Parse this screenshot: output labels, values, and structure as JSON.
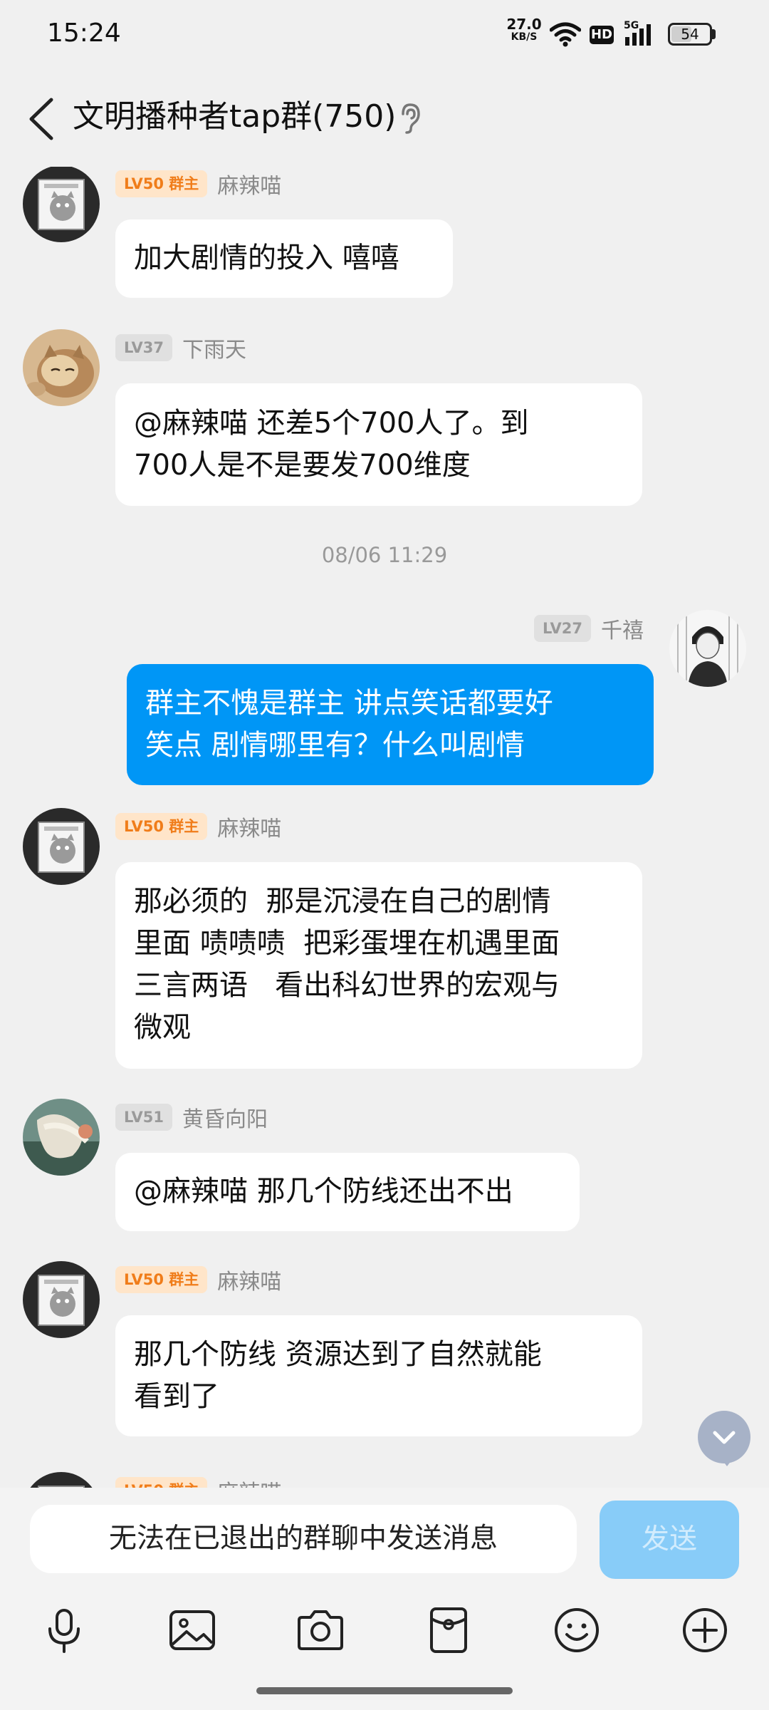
{
  "status_bar": {
    "time": "15:24",
    "net_speed_value": "27.0",
    "net_speed_unit": "KB/S",
    "hd_label": "HD",
    "signal_label": "5G",
    "battery_level": "54",
    "battery_fraction": 0.54
  },
  "header": {
    "title": "文明播种者tap群(750)",
    "back_icon": "chevron-left-icon",
    "ear_icon": "ear-icon"
  },
  "messages": [
    {
      "sender": "麻辣喵",
      "level": "LV50",
      "role": "群主",
      "side": "left",
      "avatar": "cat-cartoon-avatar",
      "text": "加大剧情的投入 嘻嘻"
    },
    {
      "sender": "下雨天",
      "level": "LV37",
      "role": "",
      "side": "left",
      "avatar": "cat-photo-avatar",
      "text": "@麻辣喵 还差5个700人了。到\n700人是不是要发700维度"
    },
    {
      "type": "timestamp",
      "text": "08/06 11:29"
    },
    {
      "sender": "千禧",
      "level": "LV27",
      "role": "",
      "side": "right",
      "avatar": "person-sketch-avatar",
      "text": "群主不愧是群主 讲点笑话都要好\n笑点 剧情哪里有？什么叫剧情"
    },
    {
      "sender": "麻辣喵",
      "level": "LV50",
      "role": "群主",
      "side": "left",
      "avatar": "cat-cartoon-avatar",
      "text": "那必须的  那是沉浸在自己的剧情\n里面 啧啧啧  把彩蛋埋在机遇里面\n三言两语   看出科幻世界的宏观与\n微观"
    },
    {
      "sender": "黄昏向阳",
      "level": "LV51",
      "role": "",
      "side": "left",
      "avatar": "mermaid-art-avatar",
      "text": "@麻辣喵 那几个防线还出不出"
    },
    {
      "sender": "麻辣喵",
      "level": "LV50",
      "role": "群主",
      "side": "left",
      "avatar": "cat-cartoon-avatar",
      "text": "那几个防线 资源达到了自然就能\n看到了"
    },
    {
      "sender": "麻辣喵",
      "level": "LV50",
      "role": "群主",
      "side": "left",
      "avatar": "cat-cartoon-avatar",
      "text": ""
    }
  ],
  "input": {
    "placeholder": "无法在已退出的群聊中发送消息",
    "send_label": "发送"
  },
  "toolbar": [
    {
      "name": "microphone-icon"
    },
    {
      "name": "image-icon"
    },
    {
      "name": "camera-icon"
    },
    {
      "name": "red-packet-icon"
    },
    {
      "name": "emoji-icon"
    },
    {
      "name": "plus-icon"
    }
  ],
  "colors": {
    "background": "#f0f0f0",
    "bubble_self": "#0096f6",
    "bubble_other": "#ffffff",
    "owner_badge_bg": "#ffe5c9",
    "owner_badge_text": "#f07d1a",
    "member_badge_bg": "#e0e0e0",
    "send_button_disabled": "#88ccf8"
  }
}
